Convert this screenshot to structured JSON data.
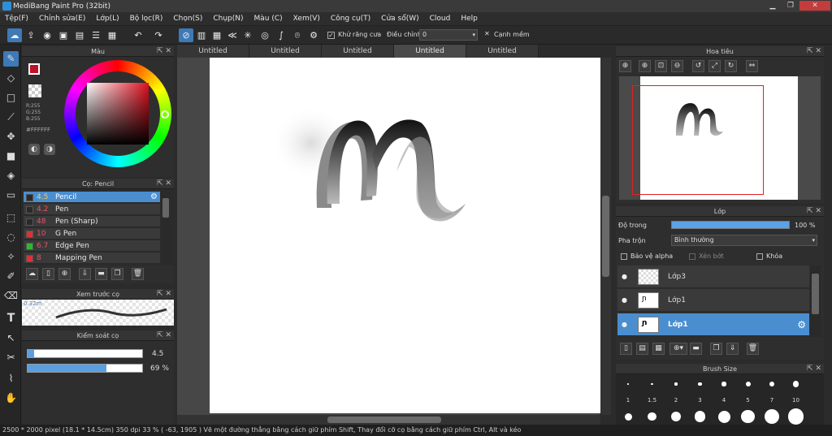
{
  "title": "MediBang Paint Pro (32bit)",
  "menu": [
    "Tệp(F)",
    "Chỉnh sửa(E)",
    "Lớp(L)",
    "Bộ lọc(R)",
    "Chọn(S)",
    "Chụp(N)",
    "Màu (C)",
    "Xem(V)",
    "Công cụ(T)",
    "Cửa sổ(W)",
    "Cloud",
    "Help"
  ],
  "toolbar": {
    "antialias_label": "Khử răng cưa",
    "correction_label": "Điều chỉnh",
    "correction_value": "0",
    "soft_edge_label": "Cạnh mềm"
  },
  "color_panel": {
    "title": "Màu",
    "rgb": "R:255\nG:255\nB:255",
    "hex": "#FFFFFF"
  },
  "brush_panel": {
    "title": "Cọ: Pencil",
    "items": [
      {
        "size": "4.5",
        "name": "Pencil",
        "color": "#2a2a2a"
      },
      {
        "size": "4.2",
        "name": "Pen",
        "color": "#2a2a2a"
      },
      {
        "size": "48",
        "name": "Pen (Sharp)",
        "color": "#2a2a2a"
      },
      {
        "size": "10",
        "name": "G Pen",
        "color": "#e03030"
      },
      {
        "size": "6.7",
        "name": "Edge Pen",
        "color": "#2eb82e"
      },
      {
        "size": "8",
        "name": "Mapping Pen",
        "color": "#e03030"
      }
    ]
  },
  "preview_panel": {
    "title": "Xem trước cọ",
    "size": "0.32m"
  },
  "control_panel": {
    "title": "Kiểm soát cọ",
    "size_value": "4.5",
    "opacity_value": "69 %",
    "size_fraction": 0.06,
    "opacity_fraction": 0.69
  },
  "tabs": [
    "Untitled",
    "Untitled",
    "Untitled",
    "Untitled",
    "Untitled"
  ],
  "navigator": {
    "title": "Hoa tiêu"
  },
  "layer_panel": {
    "title": "Lớp",
    "opacity_label": "Độ trong",
    "opacity_value": "100 %",
    "blend_label": "Pha trộn",
    "blend_value": "Bình thường",
    "protect_alpha": "Bảo vệ alpha",
    "clipping": "Xén bớt",
    "lock": "Khóa",
    "layers": [
      "Lớp3",
      "Lớp1",
      "Lớp1"
    ]
  },
  "brush_size_panel": {
    "title": "Brush Size",
    "sizes": [
      "1",
      "1.5",
      "2",
      "3",
      "4",
      "5",
      "7",
      "10"
    ]
  },
  "status": "2500 * 2000 pixel   (18.1 * 14.5cm)   350 dpi   33 %   ( -63, 1905 )   Vẽ một đường thẳng bằng cách giữ phím Shift, Thay đổi cỡ cọ bằng cách giữ phím Ctrl, Alt và kéo"
}
